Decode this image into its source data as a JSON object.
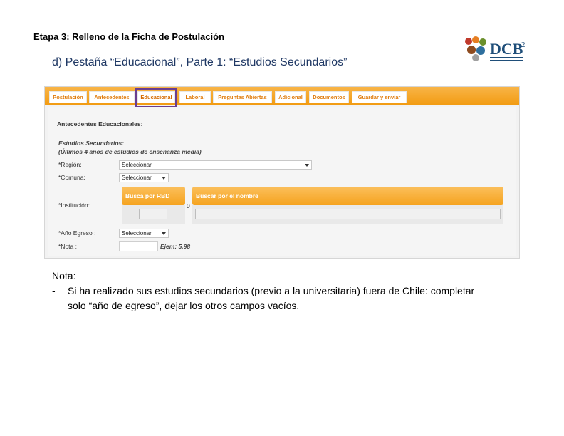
{
  "heading": "Etapa 3: Relleno de la Ficha de Postulación",
  "subheading": "d) Pestaña “Educacional”, Parte 1: “Estudios Secundarios”",
  "logo": {
    "text": "DCB",
    "superscript": "2",
    "icon": "dcb-logo-icon"
  },
  "tabs": [
    {
      "label": "Postulación"
    },
    {
      "label": "Antecedentes"
    },
    {
      "label": "Educacional",
      "active": true
    },
    {
      "label": "Laboral"
    },
    {
      "label": "Preguntas Abiertas"
    },
    {
      "label": "Adicional"
    },
    {
      "label": "Documentos"
    },
    {
      "label": "Guardar y enviar"
    }
  ],
  "form": {
    "section_title": "Antecedentes Educacionales:",
    "subsection_title": "Estudios Secundarios:",
    "subsection_note": "(Últimos 4 años de estudios de enseñanza media)",
    "region_label": "*Región:",
    "region_value": "Seleccionar",
    "comuna_label": "*Comuna:",
    "comuna_value": "Seleccionar",
    "institucion_label": "*Institución:",
    "rbd_button": "Busca por RBD",
    "nombre_button": "Buscar por el nombre",
    "zero": "0",
    "egreso_label": "*Año Egreso :",
    "egreso_value": "Seleccionar",
    "nota_label": "*Nota :",
    "nota_example": "Ejem: 5.98"
  },
  "note": {
    "title": "Nota:",
    "dash": "-",
    "text": "Si ha realizado sus estudios secundarios (previo a la universitaria) fuera de Chile: completar solo “año de egreso”, dejar los otros campos vacíos."
  },
  "colors": {
    "tab_orange": "#f29b11",
    "highlight": "#6a3d8f",
    "subheading": "#1f3864"
  }
}
